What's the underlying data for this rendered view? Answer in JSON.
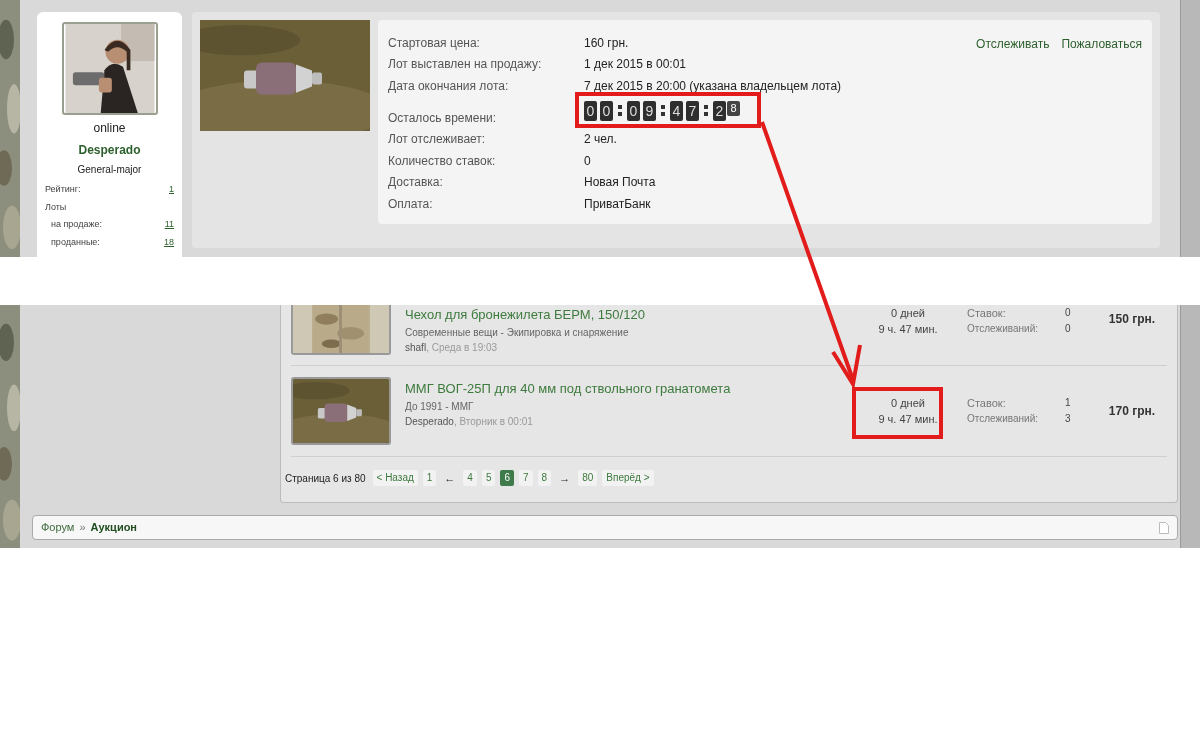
{
  "seller": {
    "status": "online",
    "name": "Desperado",
    "rank": "General-major",
    "stats": [
      {
        "label": "Рейтинг:",
        "value": "1"
      },
      {
        "label": "Лоты",
        "children": [
          {
            "label": "на продаже:",
            "value": "11"
          },
          {
            "label": "проданные:",
            "value": "18"
          }
        ]
      }
    ]
  },
  "lot": {
    "actions": [
      "Отслеживать",
      "Пожаловаться"
    ],
    "fields": [
      {
        "label": "Стартовая цена:",
        "value": "160 грн.",
        "kind": "text"
      },
      {
        "label": "Лот выставлен на продажу:",
        "value": "1 дек 2015 в 00:01",
        "kind": "text"
      },
      {
        "label": "Дата окончания лота:",
        "value": "7 дек 2015 в 20:00 (указана владельцем лота)",
        "kind": "text"
      },
      {
        "label": "Осталось времени:",
        "kind": "timer",
        "timer": [
          [
            {
              "d": "0",
              "kind": "digit"
            },
            {
              "d": "0",
              "kind": "digit"
            }
          ],
          [
            {
              "d": "0",
              "kind": "digit"
            },
            {
              "d": "9",
              "kind": "digit"
            }
          ],
          [
            {
              "d": "4",
              "kind": "digit"
            },
            {
              "d": "7",
              "kind": "digit"
            }
          ],
          [
            {
              "d": "2",
              "kind": "digit"
            },
            {
              "d": "8",
              "kind": "flipping"
            }
          ]
        ]
      },
      {
        "label": "Лот отслеживает:",
        "value": "2 чел.",
        "kind": "text"
      },
      {
        "label": "Количество ставок:",
        "value": "0",
        "kind": "text"
      },
      {
        "label": "Доставка:",
        "value": "Новая Почта",
        "kind": "text"
      },
      {
        "label": "Оплата:",
        "value": "ПриватБанк",
        "kind": "text"
      }
    ]
  },
  "listings": [
    {
      "title": "Чехол для бронежилета БЕРМ, 150/120",
      "category": "Современные вещи - Экипировка и снаряжение",
      "author": "shafl",
      "date": ", Среда в 19:03",
      "days": "0 дней",
      "hours": "9 ч. 47 мин.",
      "bids_label": "Ставок:",
      "bids": "0",
      "watch_label": "Отслеживаний:",
      "watches": "0",
      "price": "150 грн."
    },
    {
      "title": "ММГ ВОГ-25П для 40 мм под ствольного гранатомета",
      "category": "До 1991 - ММГ",
      "author": "Desperado",
      "date": ", Вторник в 00:01",
      "days": "0 дней",
      "hours": "9 ч. 47 мин.",
      "bids_label": "Ставок:",
      "bids": "1",
      "watch_label": "Отслеживаний:",
      "watches": "3",
      "price": "170 грн."
    }
  ],
  "pagination": {
    "summary": "Страница 6 из 80",
    "items": [
      {
        "label": "< Назад",
        "kind": "nav",
        "selected": false
      },
      {
        "label": "1",
        "kind": "page",
        "selected": false
      },
      {
        "label": "←",
        "kind": "arrow"
      },
      {
        "label": "4",
        "kind": "page",
        "selected": false
      },
      {
        "label": "5",
        "kind": "page",
        "selected": false
      },
      {
        "label": "6",
        "kind": "page",
        "selected": true
      },
      {
        "label": "7",
        "kind": "page",
        "selected": false
      },
      {
        "label": "8",
        "kind": "page",
        "selected": false
      },
      {
        "label": "→",
        "kind": "arrow"
      },
      {
        "label": "80",
        "kind": "page",
        "selected": false
      },
      {
        "label": "Вперёд >",
        "kind": "nav",
        "selected": false
      }
    ]
  },
  "breadcrumb": {
    "separator": "»",
    "items": [
      {
        "label": "Форум",
        "current": false
      },
      {
        "label": "Аукцион",
        "current": true
      }
    ]
  }
}
